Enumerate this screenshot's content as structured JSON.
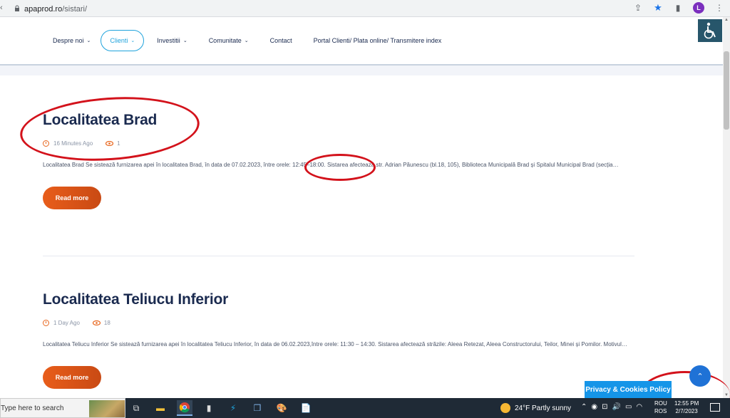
{
  "browser": {
    "url_host": "apaprod.ro",
    "url_path": "/sistari/",
    "profile_initial": "L"
  },
  "nav": {
    "items": [
      {
        "label": "Despre noi",
        "dropdown": true
      },
      {
        "label": "Clienti",
        "dropdown": true,
        "active": true
      },
      {
        "label": "Investitii",
        "dropdown": true
      },
      {
        "label": "Comunitate",
        "dropdown": true
      },
      {
        "label": "Contact",
        "dropdown": false
      },
      {
        "label": "Portal Clienti/ Plata online/ Transmitere index",
        "dropdown": false
      }
    ]
  },
  "posts": [
    {
      "title": "Localitatea Brad",
      "time_ago": "16 Minutes Ago",
      "views": "1",
      "excerpt": "Localitatea Brad Se sistează furnizarea apei în localitatea Brad, în data de 07.02.2023, între orele: 12:45–18:00. Sistarea afectează str. Adrian Păunescu (bl.18, 105), Biblioteca Municipală Brad și Spitalul Municipal Brad (secția…",
      "read_more": "Read more"
    },
    {
      "title": "Localitatea Teliucu Inferior",
      "time_ago": "1 Day Ago",
      "views": "18",
      "excerpt": "Localitatea Teliucu Inferior Se sistează furnizarea apei în localitatea Teliucu Inferior, în data de 06.02.2023,între orele: 11:30 – 14:30. Sistarea afectează străzile: Aleea Retezat, Aleea Constructorului, Teilor, Minei și Pomilor. Motivul…",
      "read_more": "Read more"
    }
  ],
  "cookies_label": "Privacy & Cookies Policy",
  "taskbar": {
    "search_placeholder": "Type here to search",
    "weather": "24°F  Partly sunny",
    "lang_1": "ROU",
    "lang_2": "ROS",
    "time": "12:55 PM",
    "date": "2/7/2023"
  },
  "colors": {
    "accent": "#1fa3dc",
    "title": "#1a2a4f",
    "button": "#e85d1a",
    "annotation": "#d3121b"
  }
}
